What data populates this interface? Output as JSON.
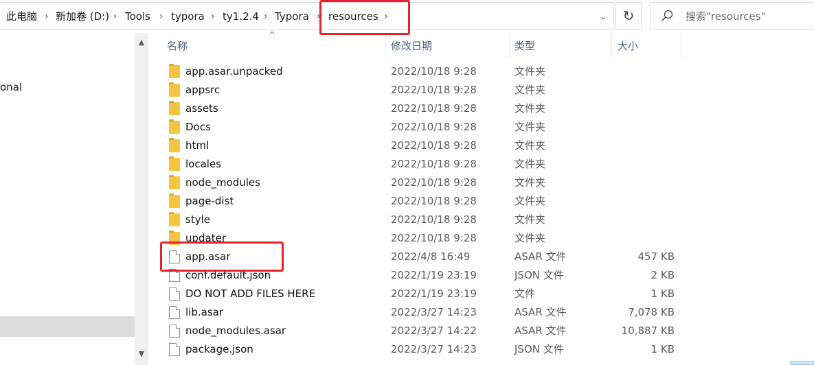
{
  "breadcrumb": {
    "items": [
      "此电脑",
      "新加卷 (D:)",
      "Tools",
      "typora",
      "ty1.2.4",
      "Typora",
      "resources"
    ]
  },
  "search": {
    "placeholder": "搜索\"resources\""
  },
  "nav": {
    "partial_label": "onal"
  },
  "columns": {
    "name": "名称",
    "date": "修改日期",
    "type": "类型",
    "size": "大小"
  },
  "files": [
    {
      "name": "app.asar.unpacked",
      "date": "2022/10/18 9:28",
      "type": "文件夹",
      "size": "",
      "kind": "folder"
    },
    {
      "name": "appsrc",
      "date": "2022/10/18 9:28",
      "type": "文件夹",
      "size": "",
      "kind": "folder"
    },
    {
      "name": "assets",
      "date": "2022/10/18 9:28",
      "type": "文件夹",
      "size": "",
      "kind": "folder"
    },
    {
      "name": "Docs",
      "date": "2022/10/18 9:28",
      "type": "文件夹",
      "size": "",
      "kind": "folder"
    },
    {
      "name": "html",
      "date": "2022/10/18 9:28",
      "type": "文件夹",
      "size": "",
      "kind": "folder"
    },
    {
      "name": "locales",
      "date": "2022/10/18 9:28",
      "type": "文件夹",
      "size": "",
      "kind": "folder"
    },
    {
      "name": "node_modules",
      "date": "2022/10/18 9:28",
      "type": "文件夹",
      "size": "",
      "kind": "folder"
    },
    {
      "name": "page-dist",
      "date": "2022/10/18 9:28",
      "type": "文件夹",
      "size": "",
      "kind": "folder"
    },
    {
      "name": "style",
      "date": "2022/10/18 9:28",
      "type": "文件夹",
      "size": "",
      "kind": "folder"
    },
    {
      "name": "updater",
      "date": "2022/10/18 9:28",
      "type": "文件夹",
      "size": "",
      "kind": "folder"
    },
    {
      "name": "app.asar",
      "date": "2022/4/8 16:49",
      "type": "ASAR 文件",
      "size": "457 KB",
      "kind": "file"
    },
    {
      "name": "conf.default.json",
      "date": "2022/1/19 23:19",
      "type": "JSON 文件",
      "size": "2 KB",
      "kind": "file"
    },
    {
      "name": "DO NOT ADD FILES HERE",
      "date": "2022/1/19 23:19",
      "type": "文件",
      "size": "1 KB",
      "kind": "file"
    },
    {
      "name": "lib.asar",
      "date": "2022/3/27 14:23",
      "type": "ASAR 文件",
      "size": "7,078 KB",
      "kind": "file"
    },
    {
      "name": "node_modules.asar",
      "date": "2022/3/27 14:22",
      "type": "ASAR 文件",
      "size": "10,887 KB",
      "kind": "file"
    },
    {
      "name": "package.json",
      "date": "2022/3/27 14:23",
      "type": "JSON 文件",
      "size": "1 KB",
      "kind": "file"
    }
  ],
  "colors": {
    "highlight": "#e8222a",
    "folder": "#f5c542",
    "header_text": "#4c607a"
  }
}
